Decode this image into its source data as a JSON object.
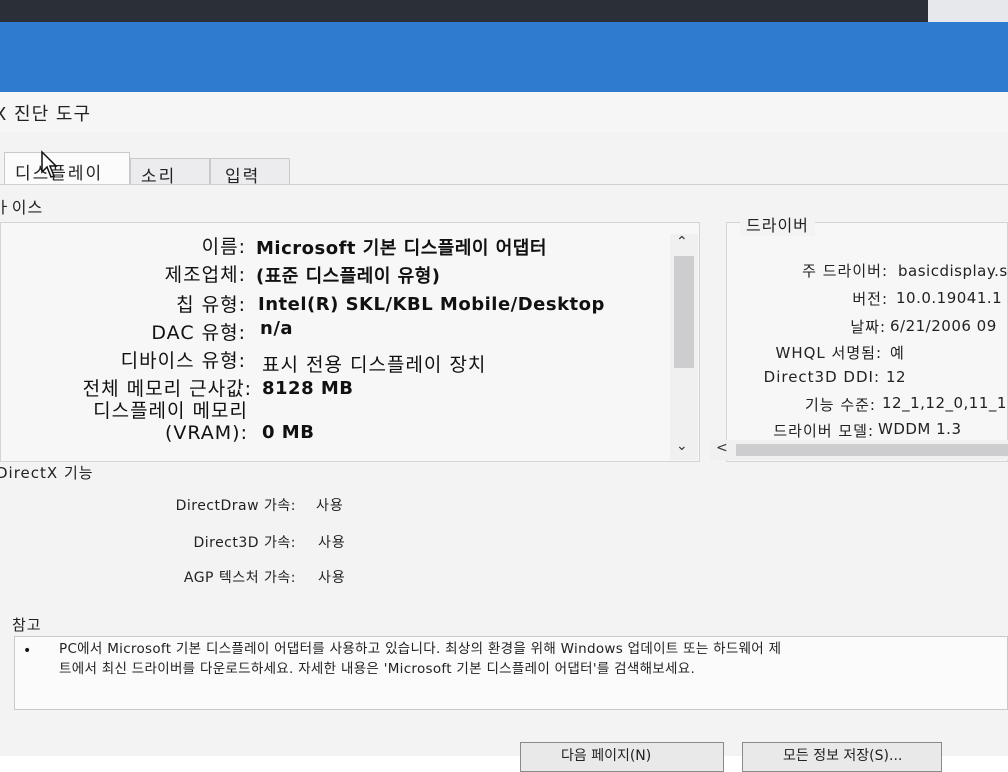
{
  "window": {
    "title": "X 진단 도구"
  },
  "tabs": [
    {
      "label": "디스플레이",
      "active": true
    },
    {
      "label": "소리",
      "active": false
    },
    {
      "label": "입력",
      "active": false
    }
  ],
  "device": {
    "section_label": "ㅏ이스",
    "rows": [
      {
        "label": "이름:",
        "value": "Microsoft 기본 디스플레이 어댑터"
      },
      {
        "label": "제조업체:",
        "value": "(표준 디스플레이 유형)"
      },
      {
        "label": "칩 유형:",
        "value": "Intel(R) SKL/KBL Mobile/Desktop"
      },
      {
        "label": "DAC 유형:",
        "value": "n/a"
      },
      {
        "label": "디바이스 유형:",
        "value": "표시 전용 디스플레이 장치"
      },
      {
        "label": "전체 메모리 근사값:",
        "value": "8128 MB"
      },
      {
        "label": "디스플레이 메모리(VRAM):",
        "value": "0 MB"
      }
    ]
  },
  "driver": {
    "section_label": "드라이버",
    "rows": [
      {
        "label": "주 드라이버:",
        "value": "basicdisplay.s"
      },
      {
        "label": "버전:",
        "value": "10.0.19041.1"
      },
      {
        "label": "날짜:",
        "value": "6/21/2006 09"
      },
      {
        "label": "WHQL 서명됨:",
        "value": "예"
      },
      {
        "label": "Direct3D DDI:",
        "value": "12"
      },
      {
        "label": "기능 수준:",
        "value": "12_1,12_0,11_1"
      },
      {
        "label": "드라이버 모델:",
        "value": "WDDM 1.3"
      }
    ]
  },
  "directx": {
    "section_label": "DirectX 기능",
    "rows": [
      {
        "label": "DirectDraw 가속:",
        "value": "사용"
      },
      {
        "label": "Direct3D 가속:",
        "value": "사용"
      },
      {
        "label": "AGP 텍스처 가속:",
        "value": "사용"
      }
    ]
  },
  "notes": {
    "section_label": "참고",
    "text": "PC에서 Microsoft 기본 디스플레이 어댑터를 사용하고 있습니다. 최상의 환경을 위해 Windows 업데이트 또는 하드웨어 제\n트에서 최신 드라이버를 다운로드하세요. 자세한 내용은 'Microsoft 기본 디스플레이 어댑터'를 검색해보세요."
  },
  "buttons": {
    "next_page": "다음 페이지(N)",
    "save_all": "모든 정보 저장(S)..."
  },
  "icons": {
    "bullet": "•",
    "scroll_up": "⌃",
    "scroll_down": "⌄",
    "scroll_left": "<"
  }
}
